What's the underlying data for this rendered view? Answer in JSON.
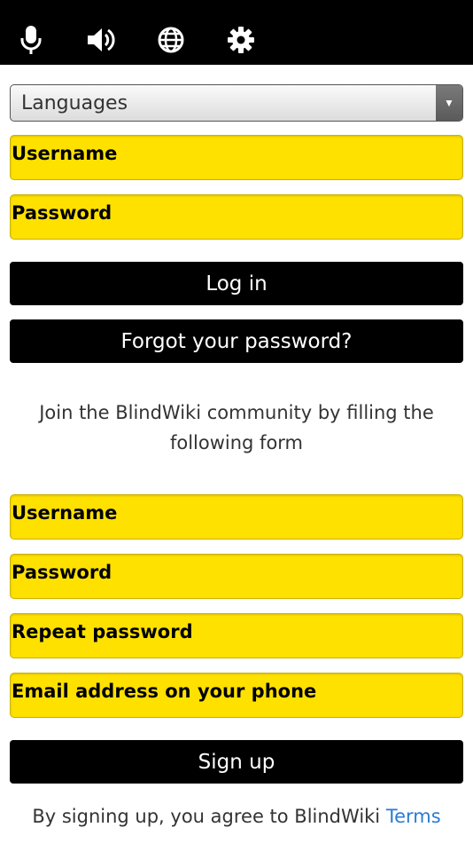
{
  "toolbar": {
    "icons": [
      "microphone-icon",
      "speaker-icon",
      "globe-icon",
      "gear-icon"
    ]
  },
  "languages": {
    "selected": "Languages"
  },
  "login": {
    "username_placeholder": "Username",
    "password_placeholder": "Password",
    "login_label": "Log in",
    "forgot_label": "Forgot your password?"
  },
  "join_text": "Join the BlindWiki community by filling the following form",
  "signup": {
    "username_placeholder": "Username",
    "password_placeholder": "Password",
    "repeat_password_placeholder": "Repeat password",
    "email_placeholder": "Email address on your phone",
    "signup_label": "Sign up"
  },
  "terms": {
    "text": "By signing up, you agree to BlindWiki ",
    "link": "Terms"
  },
  "colors": {
    "topbar": "#000000",
    "field_fill": "#ffe100",
    "button_fill": "#000000",
    "link": "#2a7bd3"
  }
}
